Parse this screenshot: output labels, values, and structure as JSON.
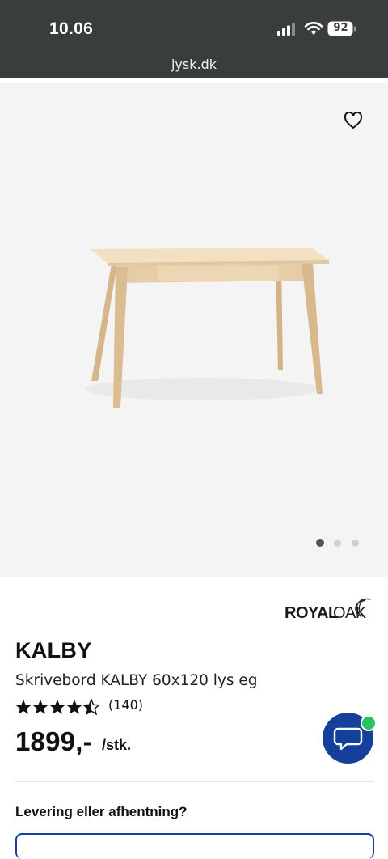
{
  "status_bar": {
    "time": "10.06",
    "battery": "92",
    "url": "jysk.dk"
  },
  "gallery": {
    "image_subject": "desk-image",
    "dots_total": 3,
    "active_dot": 1
  },
  "product": {
    "brand": "ROYALOAK",
    "name": "KALBY",
    "subtitle": "Skrivebord KALBY 60x120 lys eg",
    "rating": 4.5,
    "rating_count": "(140)",
    "price": "1899,-",
    "unit": "/stk."
  },
  "delivery": {
    "label": "Levering eller afhentning?"
  },
  "colors": {
    "accent": "#14409b",
    "online": "#22c55e",
    "status_bar_bg": "#3a3d3d"
  }
}
